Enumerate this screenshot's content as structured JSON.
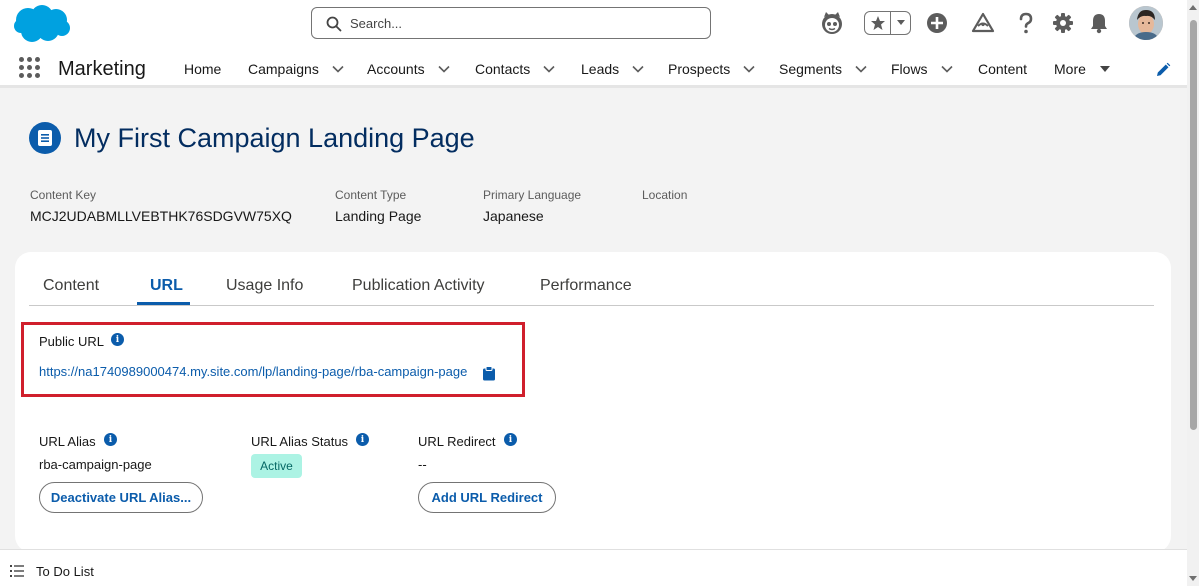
{
  "header": {
    "search_placeholder": "Search...",
    "logo": "salesforce-cloud-logo",
    "icons": [
      "assistant-icon",
      "favorites-star-icon",
      "add-icon",
      "trailhead-icon",
      "help-icon",
      "setup-gear-icon",
      "notifications-bell-icon"
    ]
  },
  "nav": {
    "app_name": "Marketing",
    "items": [
      {
        "label": "Home",
        "has_menu": false
      },
      {
        "label": "Campaigns",
        "has_menu": true
      },
      {
        "label": "Accounts",
        "has_menu": true
      },
      {
        "label": "Contacts",
        "has_menu": true
      },
      {
        "label": "Leads",
        "has_menu": true
      },
      {
        "label": "Prospects",
        "has_menu": true
      },
      {
        "label": "Segments",
        "has_menu": true
      },
      {
        "label": "Flows",
        "has_menu": true
      },
      {
        "label": "Content",
        "has_menu": false
      },
      {
        "label": "More",
        "has_menu": true
      }
    ]
  },
  "record": {
    "title": "My First Campaign Landing Page",
    "fields": [
      {
        "label": "Content Key",
        "value": "MCJ2UDABMLLVEBTHK76SDGVW75XQ"
      },
      {
        "label": "Content Type",
        "value": "Landing Page"
      },
      {
        "label": "Primary Language",
        "value": "Japanese"
      },
      {
        "label": "Location",
        "value": ""
      }
    ]
  },
  "tabs": [
    {
      "label": "Content",
      "active": false
    },
    {
      "label": "URL",
      "active": true
    },
    {
      "label": "Usage Info",
      "active": false
    },
    {
      "label": "Publication Activity",
      "active": false
    },
    {
      "label": "Performance",
      "active": false
    }
  ],
  "url_section": {
    "public_url_label": "Public URL",
    "public_url": "https://na1740989000474.my.site.com/lp/landing-page/rba-campaign-page",
    "alias_label": "URL Alias",
    "alias_value": "rba-campaign-page",
    "alias_status_label": "URL Alias Status",
    "alias_status_value": "Active",
    "redirect_label": "URL Redirect",
    "redirect_value": "--",
    "deactivate_button": "Deactivate URL Alias...",
    "add_redirect_button": "Add URL Redirect",
    "info_glyph": "i"
  },
  "utility": {
    "todo_label": "To Do List"
  },
  "colors": {
    "brand_blue": "#0b5cab",
    "salesforce_blue": "#00a1e0",
    "highlight_red": "#d01f2c",
    "active_badge_bg": "#acf3e4"
  }
}
